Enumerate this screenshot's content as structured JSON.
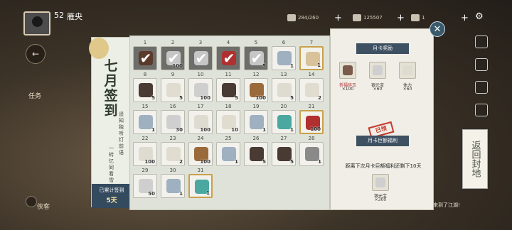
{
  "hud": {
    "level": "52",
    "player_name": "雁央",
    "res1": "284/260",
    "res2": "125507",
    "res3": "1"
  },
  "side": {
    "task_label": "任务",
    "hero_label": "侠客",
    "chat_text": "雁央：欢迎侠客来到了江湖!"
  },
  "signin": {
    "title": "七月签到",
    "poem_line1": "遥知独听灯前语",
    "poem_line2": "一转忆同看雪后山",
    "count_label": "已累计签到",
    "count_value": "5天",
    "days": [
      {
        "d": "1",
        "q": "",
        "s": "claimed",
        "c": "#5a3a2a"
      },
      {
        "d": "2",
        "q": "100",
        "s": "claimed",
        "c": "#c6c6c6"
      },
      {
        "d": "3",
        "q": "",
        "s": "claimed",
        "c": "#c6c6c6"
      },
      {
        "d": "4",
        "q": "",
        "s": "claimed",
        "c": "#b03030"
      },
      {
        "d": "5",
        "q": "5",
        "s": "claimed",
        "c": "#c6c6c6"
      },
      {
        "d": "6",
        "q": "1",
        "s": "",
        "c": "#9fb0c0"
      },
      {
        "d": "7",
        "q": "1",
        "s": "gold",
        "c": "#d9c29a"
      },
      {
        "d": "8",
        "q": "5",
        "s": "",
        "c": "#4a3a34"
      },
      {
        "d": "9",
        "q": "5",
        "s": "",
        "c": "#e0dccf"
      },
      {
        "d": "10",
        "q": "100",
        "s": "",
        "c": "#cfcfcf"
      },
      {
        "d": "11",
        "q": "5",
        "s": "",
        "c": "#4a3a34"
      },
      {
        "d": "12",
        "q": "100",
        "s": "",
        "c": "#9b6a3a"
      },
      {
        "d": "13",
        "q": "5",
        "s": "",
        "c": "#dedbd0"
      },
      {
        "d": "14",
        "q": "2",
        "s": "",
        "c": "#e0dccf"
      },
      {
        "d": "15",
        "q": "1",
        "s": "",
        "c": "#9fb0c0"
      },
      {
        "d": "16",
        "q": "30",
        "s": "",
        "c": "#cfcfcf"
      },
      {
        "d": "17",
        "q": "100",
        "s": "",
        "c": "#dedbd0"
      },
      {
        "d": "18",
        "q": "10",
        "s": "",
        "c": "#e0dccf"
      },
      {
        "d": "19",
        "q": "1",
        "s": "",
        "c": "#9fb0c0"
      },
      {
        "d": "20",
        "q": "1",
        "s": "",
        "c": "#4aa8a0"
      },
      {
        "d": "21",
        "q": "100",
        "s": "gold",
        "c": "#b03030"
      },
      {
        "d": "22",
        "q": "100",
        "s": "",
        "c": "#dedbd0"
      },
      {
        "d": "23",
        "q": "2",
        "s": "",
        "c": "#e0dccf"
      },
      {
        "d": "24",
        "q": "100",
        "s": "",
        "c": "#9b6a3a"
      },
      {
        "d": "25",
        "q": "1",
        "s": "",
        "c": "#9fb0c0"
      },
      {
        "d": "26",
        "q": "5",
        "s": "",
        "c": "#4a3a34"
      },
      {
        "d": "27",
        "q": "5",
        "s": "",
        "c": "#4a3a34"
      },
      {
        "d": "28",
        "q": "1",
        "s": "",
        "c": "#8a8a8a"
      },
      {
        "d": "29",
        "q": "50",
        "s": "",
        "c": "#cfcfcf"
      },
      {
        "d": "30",
        "q": "1",
        "s": "",
        "c": "#9fb0c0"
      },
      {
        "d": "31",
        "q": "1",
        "s": "gold",
        "c": "#4aa8a0"
      }
    ]
  },
  "monthcard": {
    "header": "月卡奖励",
    "rewards": [
      {
        "name": "祈福碎玉",
        "qty": "×100",
        "red": true,
        "c": "#7a5a4a"
      },
      {
        "name": "银元宝",
        "qty": "×60",
        "red": false,
        "c": "#cfcfcf"
      },
      {
        "name": "体力",
        "qty": "×60",
        "red": false,
        "c": "#dedbd0"
      }
    ],
    "stamp": "已领",
    "header2": "月卡巨额福利",
    "notice": "距离下次月卡巨额福利还剩下10天",
    "big_reward_name": "银元宝",
    "big_reward_qty": "×300"
  },
  "back_label": "返回封地"
}
